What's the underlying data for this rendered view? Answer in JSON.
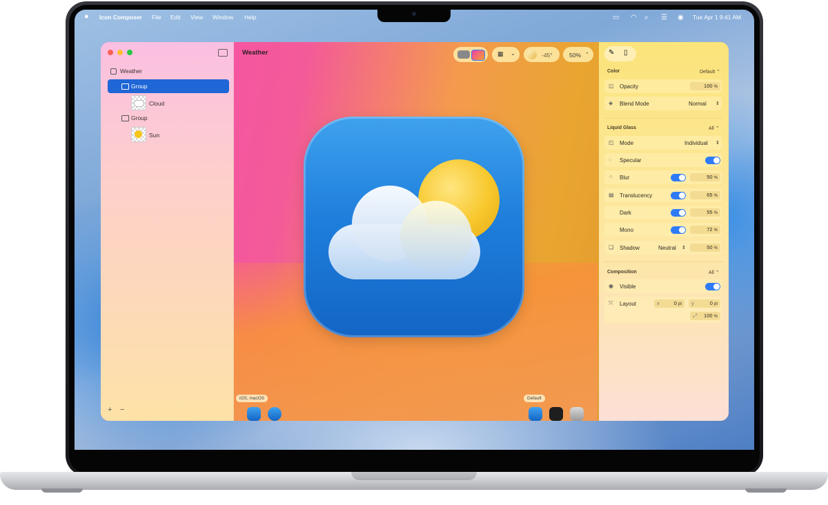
{
  "menubar": {
    "apple": "",
    "app_name": "Icon Composer",
    "items": [
      "File",
      "Edit",
      "View",
      "Window",
      "Help"
    ],
    "datetime": "Tue Apr 1  9:41 AM"
  },
  "window": {
    "title": "Weather"
  },
  "sidebar": {
    "root": "Weather",
    "items": [
      {
        "label": "Group"
      },
      {
        "label": "Cloud"
      },
      {
        "label": "Group"
      },
      {
        "label": "Sun"
      }
    ],
    "add": "+",
    "remove": "−"
  },
  "toolbar": {
    "angle": "-45°",
    "zoom": "50%",
    "zoom_chevron": "⌃"
  },
  "canvas": {
    "left_label": "iOS, macOS",
    "right_label": "Default"
  },
  "inspector": {
    "color": {
      "title": "Color",
      "menu": "Default ⌃",
      "opacity_label": "Opacity",
      "opacity_value": "100",
      "opacity_unit": "%",
      "blend_label": "Blend Mode",
      "blend_value": "Normal"
    },
    "glass": {
      "title": "Liquid Glass",
      "menu": "All ⌃",
      "mode_label": "Mode",
      "mode_value": "Individual",
      "specular_label": "Specular",
      "blur_label": "Blur",
      "blur_value": "50",
      "translucency_label": "Translucency",
      "translucency_value": "65",
      "dark_label": "Dark",
      "dark_value": "55",
      "mono_label": "Mono",
      "mono_value": "72",
      "shadow_label": "Shadow",
      "shadow_mode": "Neutral",
      "shadow_value": "50",
      "unit": "%"
    },
    "composition": {
      "title": "Composition",
      "menu": "All ⌃",
      "visible_label": "Visible",
      "layout_label": "Layout",
      "x_label": "x",
      "x_value": "0",
      "y_label": "y",
      "y_value": "0",
      "pt_unit": "pt",
      "scale_value": "100",
      "unit": "%"
    }
  },
  "colors": {
    "accent": "#2f7bf6",
    "selection": "#1f66d6",
    "close": "#fe5f57",
    "minimize": "#febc2e",
    "zoom": "#28c840"
  }
}
